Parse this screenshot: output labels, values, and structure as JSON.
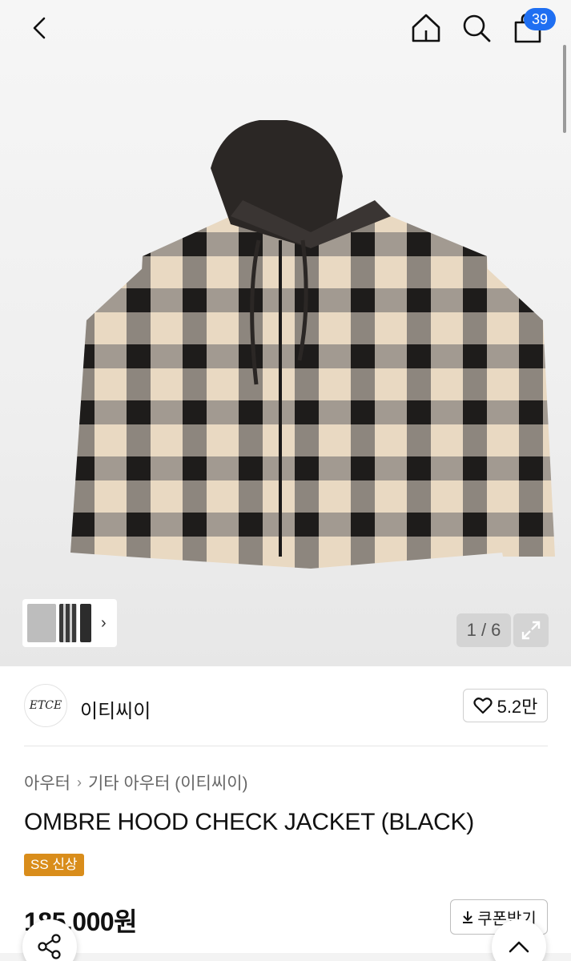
{
  "header": {
    "cart_count": "39",
    "icons": [
      "back-arrow-icon",
      "home-icon",
      "search-icon",
      "shopping-bag-icon"
    ]
  },
  "gallery": {
    "counter": "1 / 6",
    "thumbnails": [
      "grey hoodie",
      "check jacket",
      "black jacket"
    ]
  },
  "brand": {
    "logo_text": "ETCE",
    "name": "이티씨이",
    "likes": "5.2만"
  },
  "breadcrumb": {
    "level1": "아우터",
    "level2": "기타 아우터 (이티씨이)"
  },
  "product": {
    "title": "OMBRE HOOD CHECK JACKET (BLACK)",
    "tag": "SS 신상",
    "price": "185,000원",
    "coupon_label": "쿠폰받기"
  },
  "colors": {
    "badge": "#1f6ff2",
    "tag": "#d98d1b"
  }
}
